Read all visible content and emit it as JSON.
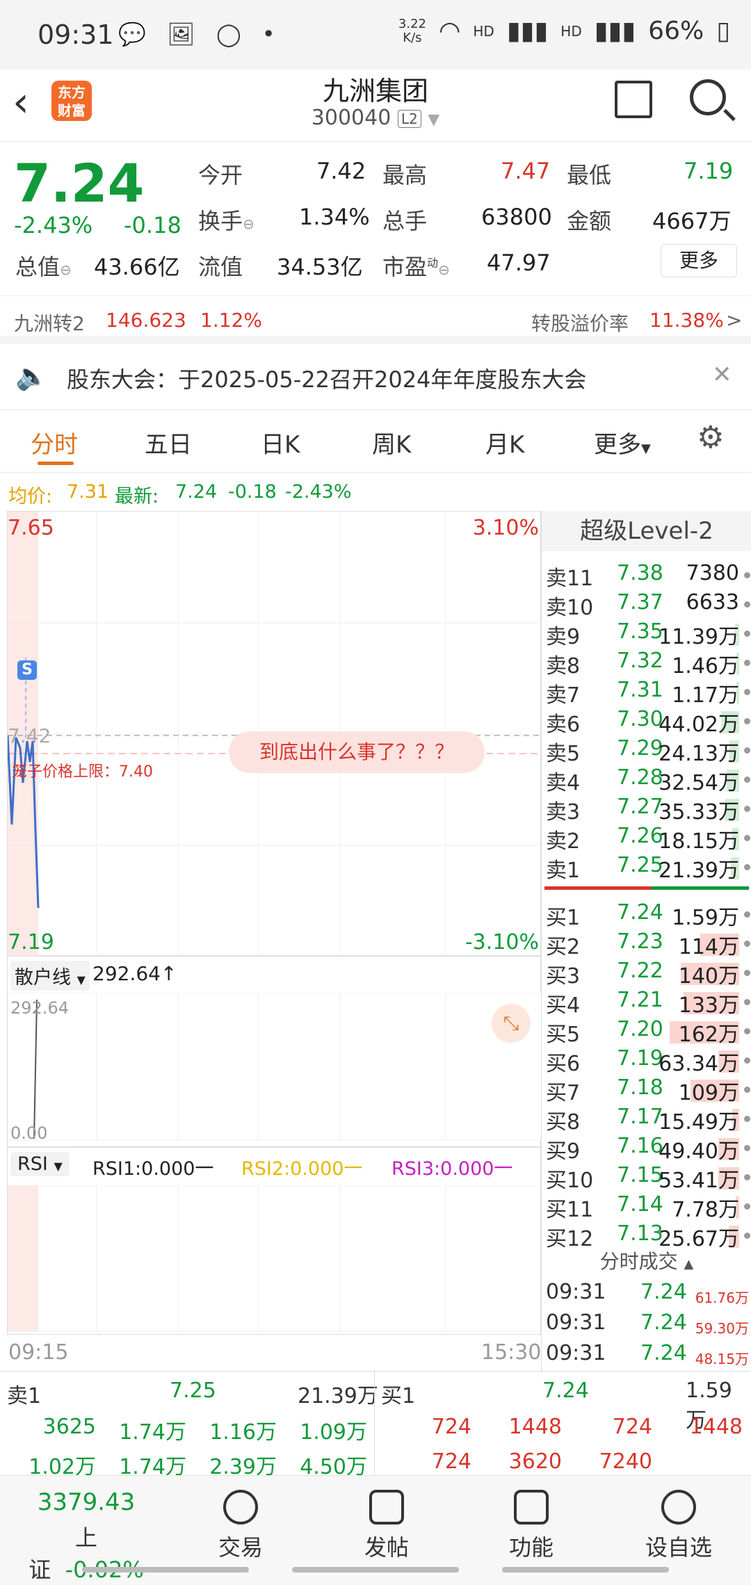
{
  "status": {
    "time": "09:31",
    "speed": "3.22\nK/s",
    "hd1": "HD",
    "hd2": "HD",
    "battery": "66%"
  },
  "header": {
    "logo": "东方财富",
    "name": "九洲集团",
    "code": "300040",
    "l2": "L2"
  },
  "quote": {
    "price": "7.24",
    "pct": "-2.43%",
    "chg": "-0.18",
    "open_l": "今开",
    "open": "7.42",
    "high_l": "最高",
    "high": "7.47",
    "low_l": "最低",
    "low": "7.19",
    "turn_l": "换手",
    "turn": "1.34%",
    "vol_l": "总手",
    "vol": "63800",
    "amt_l": "金额",
    "amt": "4667万",
    "mcap_l": "总值",
    "mcap": "43.66亿",
    "fcap_l": "流值",
    "fcap": "34.53亿",
    "pe_l": "市盈",
    "pe_sup": "动",
    "pe": "47.97",
    "more": "更多"
  },
  "convertible": {
    "name": "九洲转2",
    "price": "146.623",
    "pct": "1.12%",
    "prem_l": "转股溢价率",
    "prem": "11.38%",
    "arrow": ">"
  },
  "notice": {
    "text": "股东大会：于2025-05-22召开2024年年度股东大会",
    "close": "✕"
  },
  "tabs": [
    "分时",
    "五日",
    "日K",
    "周K",
    "月K",
    "更多"
  ],
  "avg": {
    "avg_l": "均价:",
    "avg": "7.31",
    "last_l": "最新:",
    "last": "7.24",
    "chg": "-0.18",
    "pct": "-2.43%"
  },
  "chart": {
    "ymax": "7.65",
    "ymax_pct": "3.10%",
    "ymin": "7.19",
    "ymin_pct": "-3.10%",
    "open_label": "7.42",
    "limit": "笼子价格上限：7.40",
    "bubble": "到底出什么事了？？？",
    "s": "S"
  },
  "volpanel": {
    "sel": "散户线",
    "val": "292.64↑",
    "top": "292.64",
    "bottom": "0.00"
  },
  "rsipanel": {
    "sel": "RSI",
    "r1": "RSI1:0.000一",
    "r2": "RSI2:0.000一",
    "r3": "RSI3:0.000一",
    "t0": "09:15",
    "t1": "15:30"
  },
  "l2": {
    "title": "超级Level-2",
    "asks": [
      {
        "l": "卖11",
        "p": "7.38",
        "v": "7380"
      },
      {
        "l": "卖10",
        "p": "7.37",
        "v": "6633"
      },
      {
        "l": "卖9",
        "p": "7.35",
        "v": "11.39万"
      },
      {
        "l": "卖8",
        "p": "7.32",
        "v": "1.46万"
      },
      {
        "l": "卖7",
        "p": "7.31",
        "v": "1.17万"
      },
      {
        "l": "卖6",
        "p": "7.30",
        "v": "44.02万"
      },
      {
        "l": "卖5",
        "p": "7.29",
        "v": "24.13万"
      },
      {
        "l": "卖4",
        "p": "7.28",
        "v": "32.54万"
      },
      {
        "l": "卖3",
        "p": "7.27",
        "v": "35.33万"
      },
      {
        "l": "卖2",
        "p": "7.26",
        "v": "18.15万"
      },
      {
        "l": "卖1",
        "p": "7.25",
        "v": "21.39万"
      }
    ],
    "bids": [
      {
        "l": "买1",
        "p": "7.24",
        "v": "1.59万"
      },
      {
        "l": "买2",
        "p": "7.23",
        "v": "114万"
      },
      {
        "l": "买3",
        "p": "7.22",
        "v": "140万"
      },
      {
        "l": "买4",
        "p": "7.21",
        "v": "133万"
      },
      {
        "l": "买5",
        "p": "7.20",
        "v": "162万"
      },
      {
        "l": "买6",
        "p": "7.19",
        "v": "63.34万"
      },
      {
        "l": "买7",
        "p": "7.18",
        "v": "109万"
      },
      {
        "l": "买8",
        "p": "7.17",
        "v": "15.49万"
      },
      {
        "l": "买9",
        "p": "7.16",
        "v": "49.40万"
      },
      {
        "l": "买10",
        "p": "7.15",
        "v": "53.41万"
      },
      {
        "l": "买11",
        "p": "7.14",
        "v": "7.78万"
      },
      {
        "l": "买12",
        "p": "7.13",
        "v": "25.67万"
      }
    ],
    "ticks_title": "分时成交",
    "ticks": [
      {
        "t": "09:31",
        "p": "7.24",
        "v": "61.76万"
      },
      {
        "t": "09:31",
        "p": "7.24",
        "v": "59.30万"
      },
      {
        "t": "09:31",
        "p": "7.24",
        "v": "48.15万"
      }
    ]
  },
  "bottom": {
    "ask_l": "卖1",
    "ask_p": "7.25",
    "ask_v": "21.39万",
    "bid_l": "买1",
    "bid_p": "7.24",
    "bid_v": "1.59万",
    "ask_row1": [
      "3625",
      "1.74万",
      "1.16万",
      "1.09万"
    ],
    "ask_row2": [
      "1.02万",
      "1.74万",
      "2.39万",
      "4.50万"
    ],
    "bid_row1": [
      "724",
      "1448",
      "724",
      "1448"
    ],
    "bid_row2": [
      "724",
      "3620",
      "7240"
    ]
  },
  "nav": {
    "index": "3379.43",
    "index_name": "上证",
    "index_pct": "-0.02%",
    "trade": "交易",
    "post": "发帖",
    "func": "功能",
    "watch": "设自选"
  }
}
